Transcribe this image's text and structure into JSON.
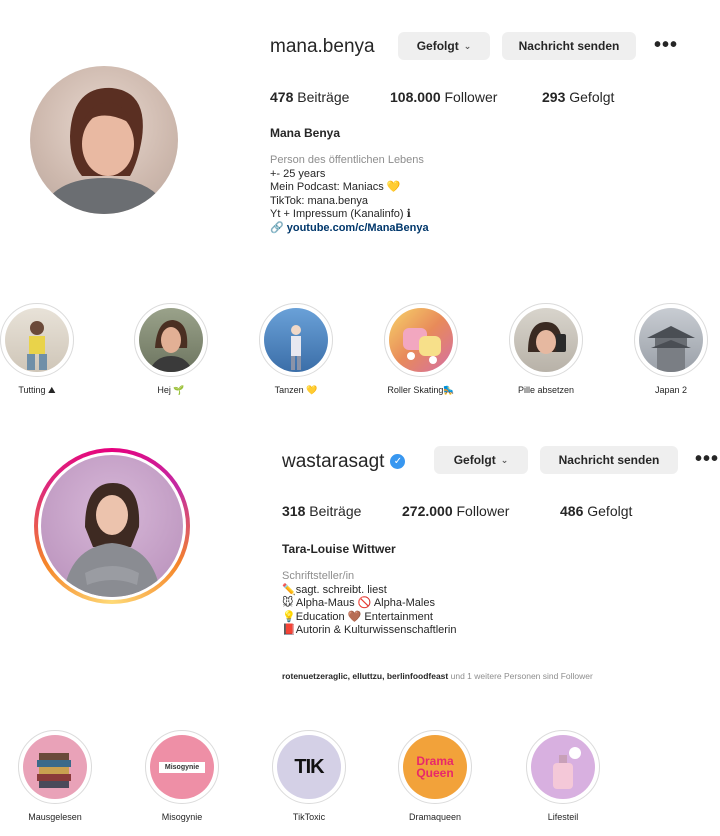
{
  "profile1": {
    "username": "mana.benya",
    "follow_button": "Gefolgt",
    "message_button": "Nachricht senden",
    "posts_count": "478",
    "posts_label": "Beiträge",
    "followers_count": "108.000",
    "followers_label": "Follower",
    "following_count": "293",
    "following_label": "Gefolgt",
    "full_name": "Mana Benya",
    "bio": {
      "category": "Person des öffentlichen Lebens",
      "lines": [
        "+- 25 years",
        "Mein Podcast: Maniacs 💛",
        "TikTok: mana.benya",
        "Yt + Impressum (Kanalinfo) ℹ"
      ],
      "link": "🔗 youtube.com/c/ManaBenya"
    }
  },
  "highlights1": [
    {
      "label": "Tutting ⛰"
    },
    {
      "label": "Hej 🌱"
    },
    {
      "label": "Tanzen 💛"
    },
    {
      "label": "Roller Skating🛼"
    },
    {
      "label": "Pille absetzen"
    },
    {
      "label": "Japan 2"
    }
  ],
  "profile2": {
    "username": "wastarasagt",
    "verified_icon": "✓",
    "follow_button": "Gefolgt",
    "message_button": "Nachricht senden",
    "posts_count": "318",
    "posts_label": "Beiträge",
    "followers_count": "272.000",
    "followers_label": "Follower",
    "following_count": "486",
    "following_label": "Gefolgt",
    "full_name": "Tara-Louise Wittwer",
    "bio": {
      "category": "Schriftsteller/in",
      "lines": [
        "✏️sagt. schreibt. liest",
        "🐭 Alpha-Maus 🚫 Alpha-Males",
        "💡Education 🤎 Entertainment",
        "📕Autorin & Kulturwissenschaftlerin"
      ]
    },
    "followed_by_names": "rotenuetzeraglic, elluttzu, berlinfoodfeast",
    "followed_by_rest": " und 1 weitere Personen sind Follower"
  },
  "highlights2": [
    {
      "label": "Mausgelesen"
    },
    {
      "label": "Misogynie",
      "inner_text": "Misogynie"
    },
    {
      "label": "TikToxic",
      "inner_text": "TIK"
    },
    {
      "label": "Dramaqueen",
      "inner_text": "Drama Queen"
    },
    {
      "label": "Lifesteil"
    }
  ],
  "icons": {
    "more": "•••",
    "chevron": "⌄"
  }
}
